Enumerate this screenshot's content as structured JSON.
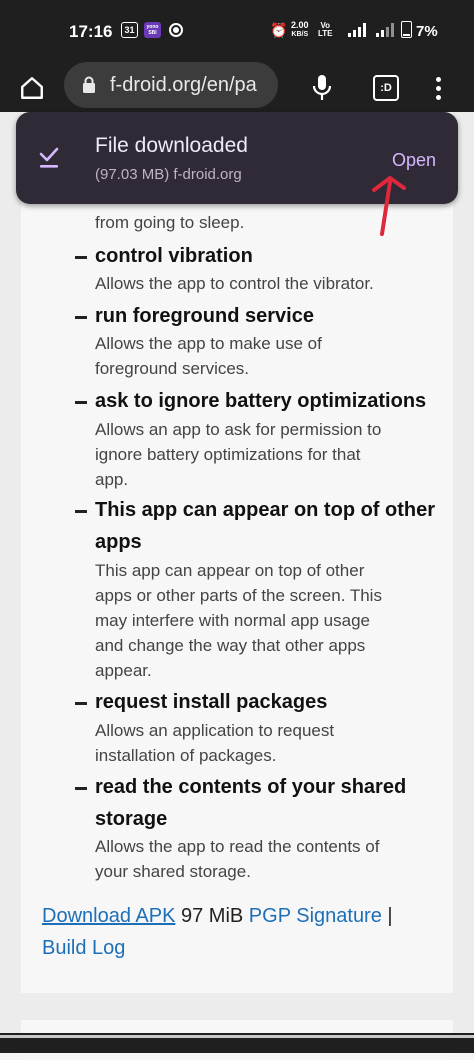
{
  "status_bar": {
    "time": "17:16",
    "calendar_badge": "31",
    "app_badge": "yono SBI",
    "speed_value": "2.00",
    "speed_unit": "KB/S",
    "volte_top": "Vo",
    "volte_bottom": "LTE",
    "battery_text": "7%"
  },
  "toolbar": {
    "url": "f-droid.org/en/pa",
    "tabs_label": ":D"
  },
  "snackbar": {
    "title": "File downloaded",
    "subtitle": "(97.03 MB) f-droid.org",
    "action": "Open",
    "accent": "#d6b8ff"
  },
  "permissions": [
    {
      "title": "",
      "desc": [
        "from going to sleep."
      ]
    },
    {
      "title": "control vibration",
      "desc": [
        "Allows the app to control the vibrator."
      ]
    },
    {
      "title": "run foreground service",
      "desc": [
        "Allows the app to make use of",
        "foreground services."
      ]
    },
    {
      "title": "ask to ignore battery optimizations",
      "desc": [
        "Allows an app to ask for permission to",
        "ignore battery optimizations for that",
        "app."
      ]
    },
    {
      "title_lines": [
        "This app can appear on top of other",
        "apps"
      ],
      "desc": [
        "This app can appear on top of other",
        "apps or other parts of the screen. This",
        "may interfere with normal app usage",
        "and change the way that other apps",
        "appear."
      ]
    },
    {
      "title": "request install packages",
      "desc": [
        "Allows an application to request",
        "installation of packages."
      ]
    },
    {
      "title_lines": [
        "read the contents of your shared",
        "storage"
      ],
      "desc": [
        "Allows the app to read the contents of",
        "your shared storage."
      ]
    }
  ],
  "download": {
    "link_label": "Download APK",
    "size": "97 MiB",
    "pgp_label": "PGP Signature",
    "separator": "|",
    "build_log_label": "Build Log",
    "link_color": "#1d6fb8"
  }
}
